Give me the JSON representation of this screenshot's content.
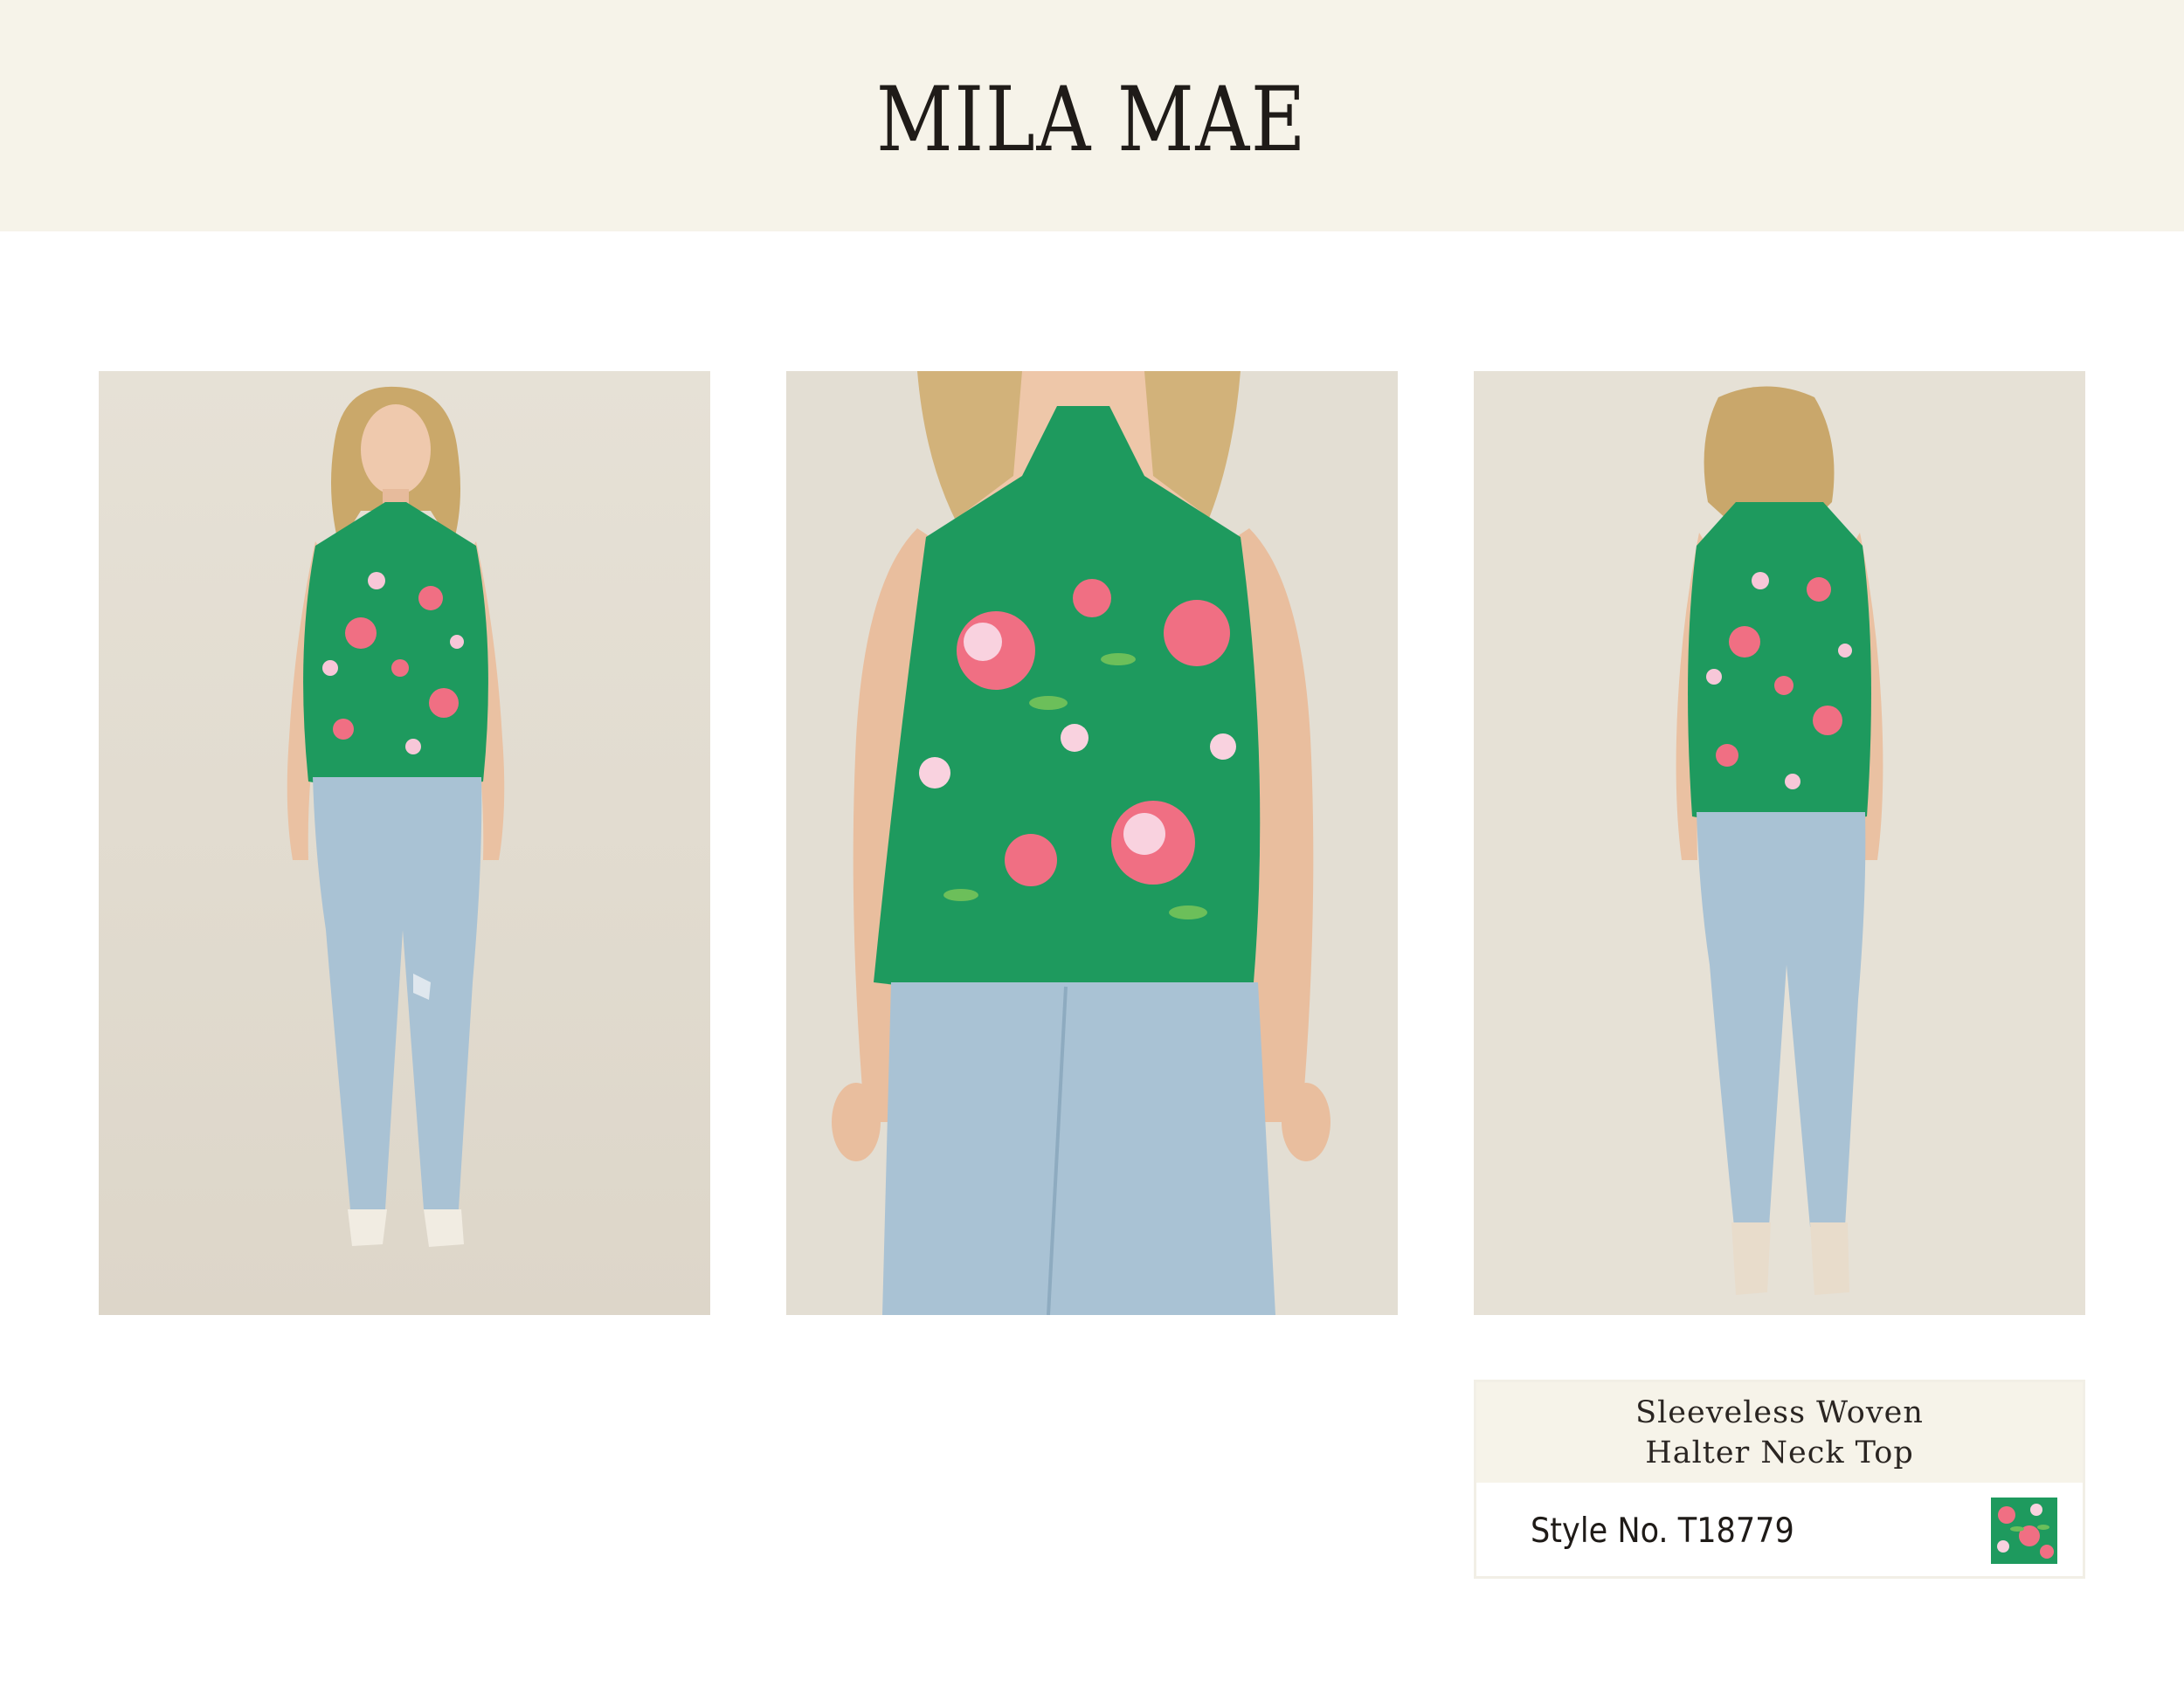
{
  "header": {
    "brand_name": "MILA MAE",
    "background_color": "#f6f3e9"
  },
  "gallery": {
    "photos": [
      {
        "view": "front-full-length"
      },
      {
        "view": "front-close-up"
      },
      {
        "view": "back-full-length"
      }
    ]
  },
  "product": {
    "title": "Sleeveless Woven Halter Neck Top",
    "style_number": "Style No. T18779",
    "print_color": "#1e9a5e"
  }
}
